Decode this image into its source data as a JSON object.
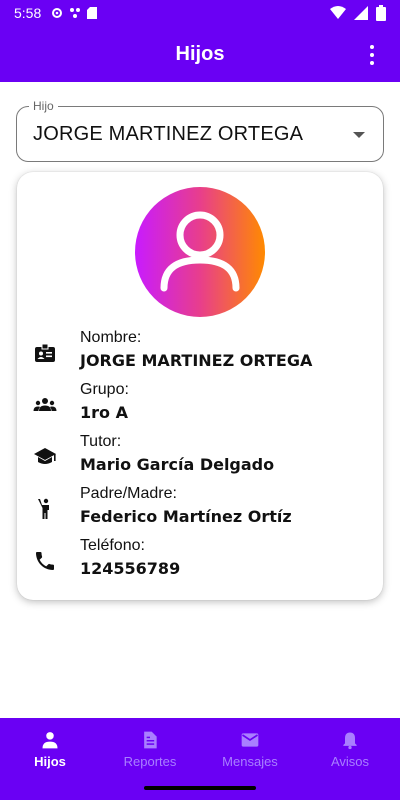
{
  "status_bar": {
    "time": "5:58"
  },
  "app_bar": {
    "title": "Hijos",
    "menu_icon": "more-vert-icon"
  },
  "child_select": {
    "label": "Hijo",
    "value": "JORGE MARTINEZ ORTEGA"
  },
  "profile": {
    "avatar_icon": "person-outline-icon",
    "avatar_gradient": [
      "#c81bff",
      "#ff8a00"
    ],
    "fields": [
      {
        "icon": "badge-icon",
        "label": "Nombre:",
        "value": "JORGE MARTINEZ ORTEGA"
      },
      {
        "icon": "group-icon",
        "label": "Grupo:",
        "value": "1ro A"
      },
      {
        "icon": "school-icon",
        "label": "Tutor:",
        "value": "Mario García Delgado"
      },
      {
        "icon": "person-raised-hand-icon",
        "label": "Padre/Madre:",
        "value": "Federico Martínez Ortíz"
      },
      {
        "icon": "phone-icon",
        "label": "Teléfono:",
        "value": "124556789"
      }
    ]
  },
  "bottom_nav": {
    "items": [
      {
        "label": "Hijos",
        "icon": "person-icon",
        "active": true
      },
      {
        "label": "Reportes",
        "icon": "description-icon",
        "active": false
      },
      {
        "label": "Mensajes",
        "icon": "mail-icon",
        "active": false
      },
      {
        "label": "Avisos",
        "icon": "bell-icon",
        "active": false
      }
    ]
  },
  "colors": {
    "primary": "#6a00f4",
    "nav_inactive": "#a97fff",
    "nav_active": "#ffffff"
  }
}
